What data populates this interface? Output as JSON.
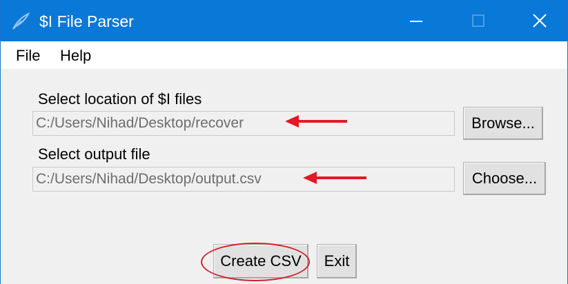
{
  "window": {
    "title": "$I File Parser",
    "app_icon": "feather-icon",
    "controls": {
      "minimize_icon": "minimize-icon",
      "maximize_icon": "maximize-icon",
      "close_icon": "close-icon"
    }
  },
  "menu": {
    "items": [
      {
        "label": "File"
      },
      {
        "label": "Help"
      }
    ]
  },
  "form": {
    "location_label": "Select location of $I files",
    "location_value": "C:/Users/Nihad/Desktop/recover",
    "browse_label": "Browse...",
    "output_label": "Select output file",
    "output_value": "C:/Users/Nihad/Desktop/output.csv",
    "choose_label": "Choose..."
  },
  "actions": {
    "create_label": "Create CSV",
    "exit_label": "Exit"
  },
  "annotations": {
    "arrow_color": "#e01a24",
    "ellipse_color": "#d0202a"
  },
  "colors": {
    "titlebar": "#0a78d7",
    "window_bg": "#f0f0f0",
    "menubar_bg": "#ffffff"
  }
}
